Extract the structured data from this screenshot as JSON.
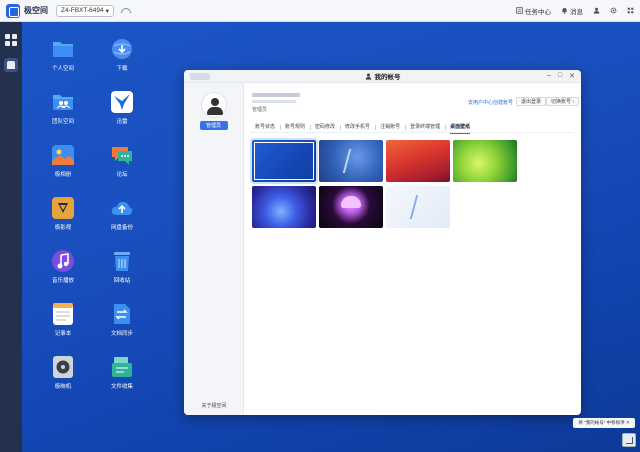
{
  "topbar": {
    "brand": "极空间",
    "device": "Z4-FBXT-6494",
    "device_chevron": "▾",
    "task_center": "任务中心",
    "messages": "消息"
  },
  "desktop_icons": [
    {
      "label": "个人空间",
      "icon": "folder-icon",
      "color": "#3b8ff0"
    },
    {
      "label": "下载",
      "icon": "download-globe-icon",
      "color": "#2f78e6"
    },
    {
      "label": "团队空间",
      "icon": "team-folder-icon",
      "color": "#3b8ff0"
    },
    {
      "label": "迅雷",
      "icon": "thunder-bird-icon",
      "color": "#ffffff"
    },
    {
      "label": "极相册",
      "icon": "photo-album-icon",
      "color": "#3d8df2"
    },
    {
      "label": "论坛",
      "icon": "forum-chat-icon",
      "color": "#f07b3c"
    },
    {
      "label": "极影视",
      "icon": "movie-icon",
      "color": "#e6a43c"
    },
    {
      "label": "网盘备份",
      "icon": "cloud-upload-icon",
      "color": "#3b8ff0"
    },
    {
      "label": "音乐播放",
      "icon": "music-note-icon",
      "color": "#7b4de0"
    },
    {
      "label": "回收站",
      "icon": "trash-icon",
      "color": "#3b8ff0"
    },
    {
      "label": "记事本",
      "icon": "notepad-icon",
      "color": "#f5b14a"
    },
    {
      "label": "文档同步",
      "icon": "sync-icon",
      "color": "#3b8ff0"
    },
    {
      "label": "极映机",
      "icon": "disk-icon",
      "color": "#cfd4dc"
    },
    {
      "label": "文件收集",
      "icon": "file-collect-icon",
      "color": "#2fb39b"
    }
  ],
  "window": {
    "title": "我的帐号",
    "user_role": "管理员",
    "avatar_label": "管理员",
    "about": "关于极空间",
    "create_account_link": "去用户中心创建账号",
    "logout_btn": "退出登录",
    "switch_btn": "切换账号 ›",
    "tabs": [
      "账号状态",
      "账号规则",
      "密码修改",
      "修改手机号",
      "注销账号",
      "登录终端管理",
      "桌面壁纸"
    ],
    "active_tab": "桌面壁纸",
    "controls": {
      "minimize": "–",
      "maximize": "□",
      "close": "✕"
    }
  },
  "wallpapers": [
    {
      "name": "blue-solid",
      "selected": true
    },
    {
      "name": "blue-z-logo",
      "selected": false
    },
    {
      "name": "red-waves",
      "selected": false
    },
    {
      "name": "green-swirl",
      "selected": false
    },
    {
      "name": "blue-flower",
      "selected": false
    },
    {
      "name": "jellyfish",
      "selected": false
    },
    {
      "name": "white-z-logo",
      "selected": false
    }
  ],
  "tooltip": "将 \"我的帐号\" 中移除项 ✕"
}
